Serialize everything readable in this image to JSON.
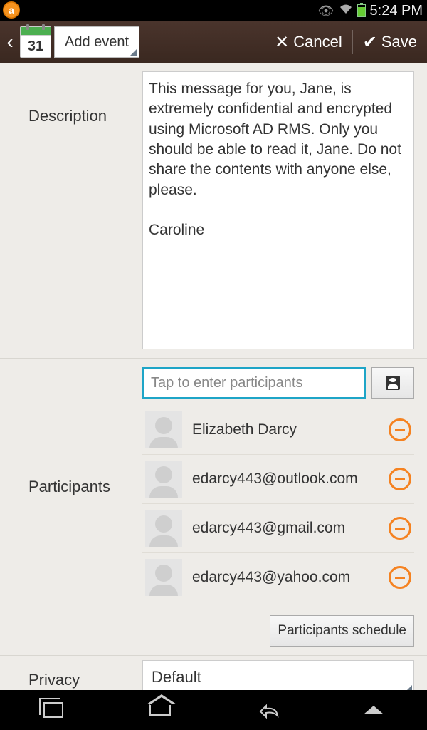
{
  "status": {
    "time": "5:24 PM"
  },
  "appbar": {
    "calendar_day": "31",
    "add_event_label": "Add event",
    "cancel_label": "Cancel",
    "save_label": "Save"
  },
  "description": {
    "label": "Description",
    "text": "This message for you, Jane, is extremely confidential and encrypted using Microsoft AD RMS. Only you should be able to read it, Jane. Do not share the contents with anyone else, please.\n\nCaroline"
  },
  "participants": {
    "label": "Participants",
    "input_placeholder": "Tap to enter participants",
    "items": [
      {
        "name": "Elizabeth Darcy"
      },
      {
        "name": "edarcy443@outlook.com"
      },
      {
        "name": "edarcy443@gmail.com"
      },
      {
        "name": "edarcy443@yahoo.com"
      }
    ],
    "schedule_button": "Participants schedule"
  },
  "privacy": {
    "label": "Privacy",
    "value": "Default"
  }
}
